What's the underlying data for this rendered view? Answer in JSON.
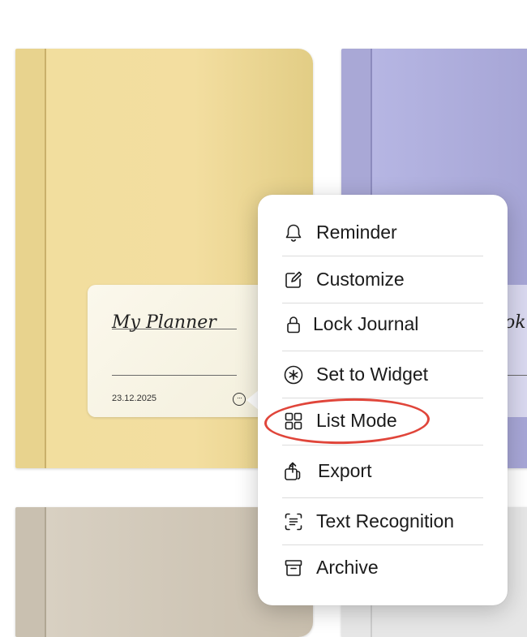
{
  "journals": [
    {
      "color": "#f2de9e",
      "label": {
        "title": "My Planner",
        "date": "23.12.2025"
      }
    },
    {
      "color": "#b6b6e3",
      "label": {
        "title_fragment": "ok"
      }
    },
    {
      "color": "#d8d0c2"
    },
    {
      "color": "#e6e6e6"
    }
  ],
  "context_menu": {
    "items": [
      {
        "label": "Reminder",
        "icon": "bell-icon"
      },
      {
        "label": "Customize",
        "icon": "edit-icon"
      },
      {
        "label": "Lock Journal",
        "icon": "lock-icon"
      },
      {
        "label": "Set to Widget",
        "icon": "asterisk-circle-icon"
      },
      {
        "label": "List Mode",
        "icon": "grid-icon",
        "highlighted": true
      },
      {
        "label": "Export",
        "icon": "share-icon"
      },
      {
        "label": "Text Recognition",
        "icon": "text-scan-icon"
      },
      {
        "label": "Archive",
        "icon": "archive-box-icon"
      }
    ]
  },
  "colors": {
    "highlight_ring": "#e0453a",
    "menu_text": "#1b1b1b"
  }
}
